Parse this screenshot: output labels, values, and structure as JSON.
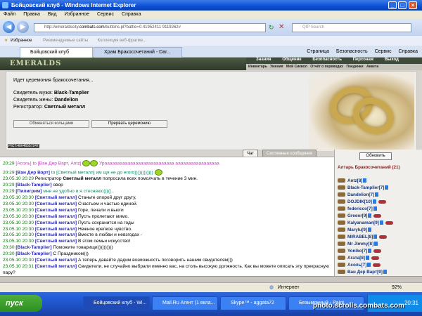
{
  "window": {
    "title": "Бойцовский клуб - Windows Internet Explorer",
    "min": "_",
    "max": "□",
    "close": "×"
  },
  "menu": [
    "Файл",
    "Правка",
    "Вид",
    "Избранное",
    "Сервис",
    "Справка"
  ],
  "address": {
    "prefix": "http://emeraldscity.",
    "domain": "combats.com",
    "suffix": "/buttons.pl?battle=0.41952411 9119262#"
  },
  "search_placeholder": "QIP Search",
  "favorites": {
    "label": "Избранное",
    "suggested": "Рекомендуемые сайты",
    "gallery": "Коллекция веб-фрагме..."
  },
  "tabs": [
    "Бойцовский клуб",
    "Храм Бракосочетаний - Dar..."
  ],
  "tools": [
    "Страница",
    "Безопасность",
    "Сервис",
    "Справка"
  ],
  "game": {
    "logo": "EMERALDS",
    "menu": [
      "Знания",
      "Общение",
      "Безопасность",
      "Персонаж",
      "Выход"
    ],
    "submenu": [
      "Инвентарь",
      "Умения",
      "Мой Сиквол",
      "Отчёт о переводах",
      "Поединки",
      "Анкета"
    ],
    "ceremony": {
      "status": "Идет церемония бракосочетания...",
      "witness_husband_label": "Свидетель мужа:",
      "witness_husband": "Black-Tamplier",
      "witness_wife_label": "Свидетель жены:",
      "witness_wife": "Dandelion",
      "registrar_label": "Регистратор:",
      "registrar": "Светлый металл",
      "btn_rings": "Обменяться кольцами",
      "btn_interrupt": "Прервать церемонию",
      "id": "PICT:40#46557247"
    },
    "chat_tabs": [
      "Чат",
      "Системные сообщения"
    ],
    "refresh": "Обновить",
    "altar_title": "Алтарь Бракосочетаний (21)",
    "users": [
      "Antz[8]",
      "Black-Tamplier[7]",
      "Dandelion[7]",
      "DOJDIK[10]",
      "federicco[7]",
      "Greenr[9]",
      "Kalyanaman[9]",
      "Marylu[9]",
      "MIRABEL[8]",
      "Mr Jimmy[8]",
      "Yoniko[7]",
      "Агата[8]",
      "Асоль[7]",
      "Ван Дер Варт[9]",
      "ГЛЮКоза[9]"
    ]
  },
  "chat": [
    {
      "t": "20:29",
      "a": "[Асоль]",
      "b": " to [Ван Дер Варт, Antz] ",
      "c": "Урааааааааааааааааааааааааааа ааааааааааааааааа"
    },
    {
      "t": "20:29",
      "a": "[Ван Дер Варт]",
      "b": " to [Светлый металл] им щя не до егого))))))))))))",
      "c": ""
    },
    {
      "t": "23.05.10 20:29",
      "a": "",
      "b": "Регистратор ",
      "c": "Светлый металл",
      "d": " попросила всех помолчать в течение 3 мин."
    },
    {
      "t": "20:29",
      "a": "[Black-Tamplier]",
      "b": " овор",
      "c": ""
    },
    {
      "t": "20:29",
      "a": "[Пилигрим]",
      "b": " мне не удобно и я стесняюс(((((..",
      "c": ""
    },
    {
      "t": "23.05.10 20:30",
      "a": "[Светлый металл]",
      "b": " Станьте опорой друг другу,",
      "c": ""
    },
    {
      "t": "23.05.10 20:30",
      "a": "[Светлый металл]",
      "b": " Счастьем и частью единой.",
      "c": ""
    },
    {
      "t": "23.05.10 20:30",
      "a": "[Светлый металл]",
      "b": " Горе, печали и вьюги",
      "c": ""
    },
    {
      "t": "23.05.10 20:30",
      "a": "[Светлый металл]",
      "b": " Пусть пролетают мимо.",
      "c": ""
    },
    {
      "t": "23.05.10 20:30",
      "a": "[Светлый металл]",
      "b": " Пусть сохранится на годы",
      "c": ""
    },
    {
      "t": "23.05.10 20:30",
      "a": "[Светлый металл]",
      "b": " Нежное крепкое чувство.",
      "c": ""
    },
    {
      "t": "23.05.10 20:30",
      "a": "[Светлый металл]",
      "b": " Вместе в любви и невзгодах -",
      "c": ""
    },
    {
      "t": "23.05.10 20:30",
      "a": "[Светлый металл]",
      "b": " В этом семьи искусство!",
      "c": ""
    },
    {
      "t": "20:30",
      "a": "[Black-Tamplier]",
      "b": " Поможите товарищи))))))))))",
      "c": ""
    },
    {
      "t": "20:30",
      "a": "[Black-Tamplier]",
      "b": " С Праздником)))",
      "c": ""
    },
    {
      "t": "23.05.10 20:30",
      "a": "[Светлый металл]",
      "b": " А теперь давайте дадим возможность поговорить нашим свидетелям)))",
      "c": ""
    },
    {
      "t": "23.05.10 20:31",
      "a": "[Светлый металл]",
      "b": " Свидетели, не случайно выбрали именно вас, на столь высокую должность. Как вы можете описать эту прекрасную пару?",
      "c": ""
    }
  ],
  "status": {
    "zone": "Интернет",
    "zoom": "92%"
  },
  "taskbar": {
    "start": "пуск",
    "items": [
      "Бойцовский клуб - Wi...",
      "Mail.Ru Агент (1 вкла...",
      "Skype™ - aggata72",
      "Безымянный - Paint"
    ],
    "time": "20:31"
  },
  "watermark": "photo.scrolls.combats.com"
}
